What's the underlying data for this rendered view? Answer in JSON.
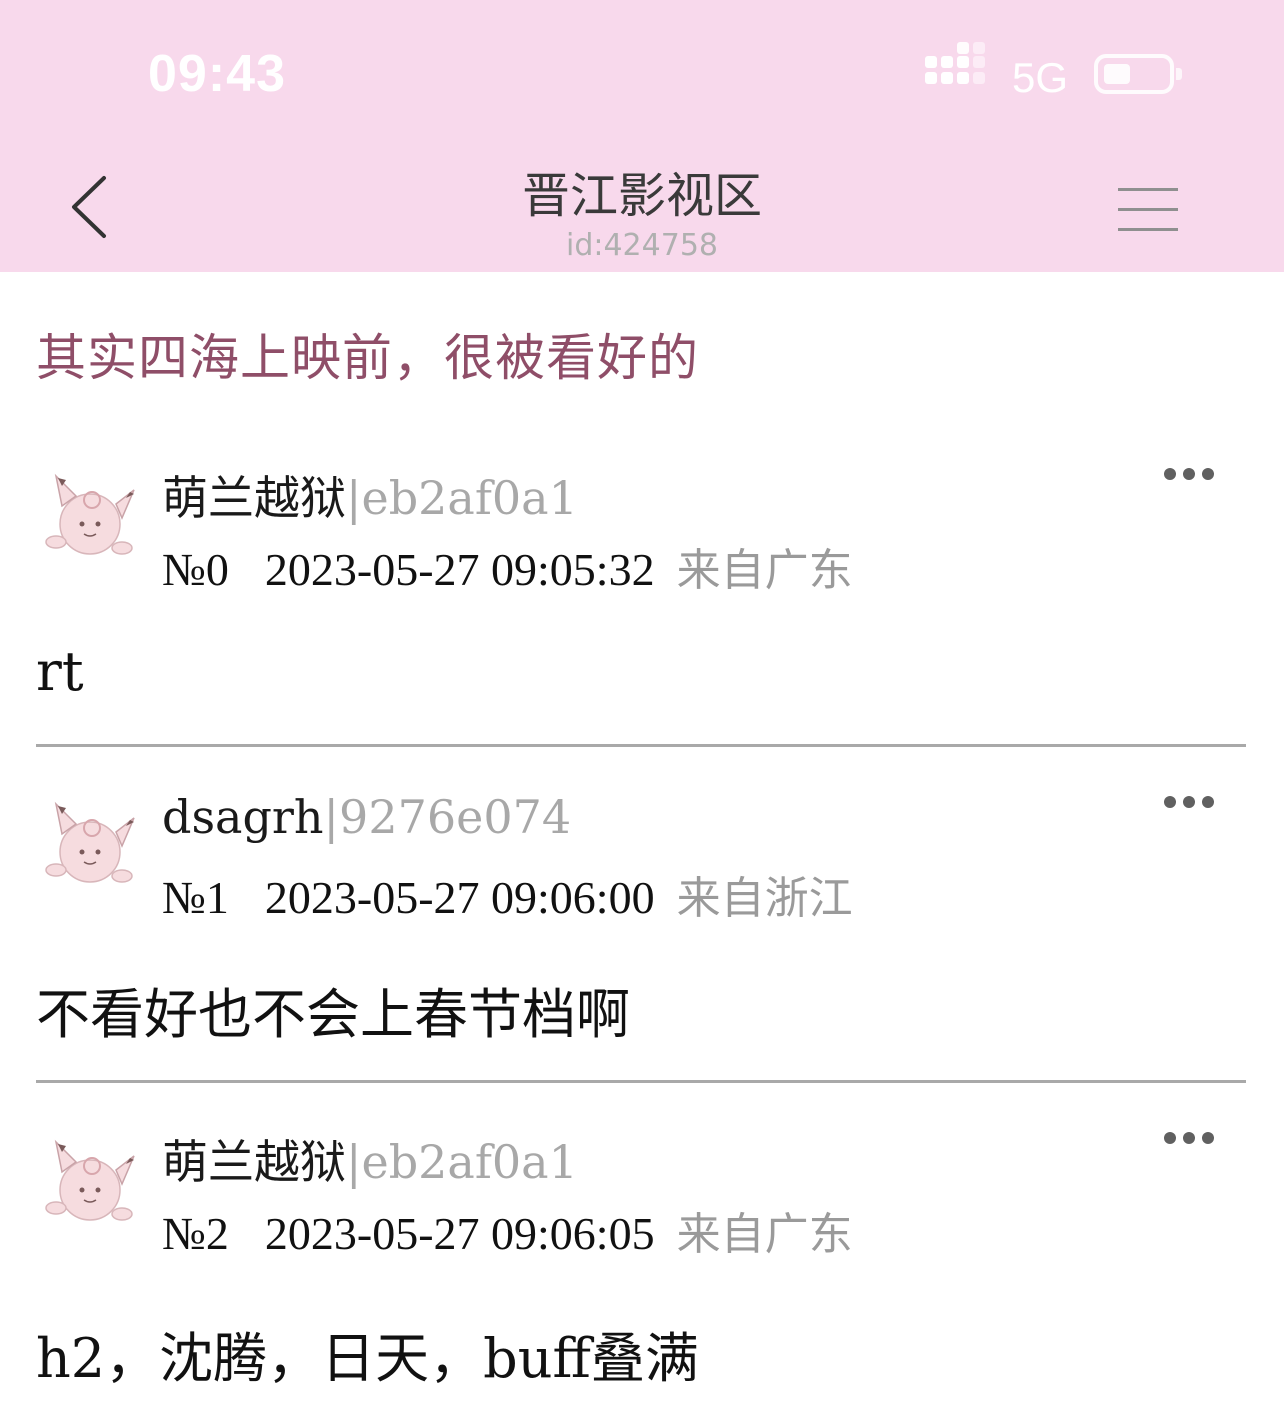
{
  "status_bar": {
    "time": "09:43",
    "network": "5G"
  },
  "nav": {
    "title": "晋江影视区",
    "subtitle": "id:424758"
  },
  "thread": {
    "title": "其实四海上映前，很被看好的"
  },
  "posts": [
    {
      "author": "萌兰越狱",
      "separator": "|",
      "hash": "eb2af0a1",
      "floor": "№0",
      "datetime": "2023-05-27 09:05:32",
      "location": "来自广东",
      "content": "rt"
    },
    {
      "author": "dsagrh",
      "separator": "|",
      "hash": "9276e074",
      "floor": "№1",
      "datetime": "2023-05-27 09:06:00",
      "location": "来自浙江",
      "content": "不看好也不会上春节档啊"
    },
    {
      "author": "萌兰越狱",
      "separator": "|",
      "hash": "eb2af0a1",
      "floor": "№2",
      "datetime": "2023-05-27 09:06:05",
      "location": "来自广东",
      "content": "h2，沈腾，日天，buff叠满"
    }
  ],
  "colors": {
    "header_bg": "#f8d9ec",
    "thread_title": "#8f4e68",
    "meta_gray": "#9a9a9a"
  },
  "icons": [
    "signal-icon",
    "battery-icon",
    "back-icon",
    "menu-icon",
    "more-icon",
    "avatar"
  ]
}
